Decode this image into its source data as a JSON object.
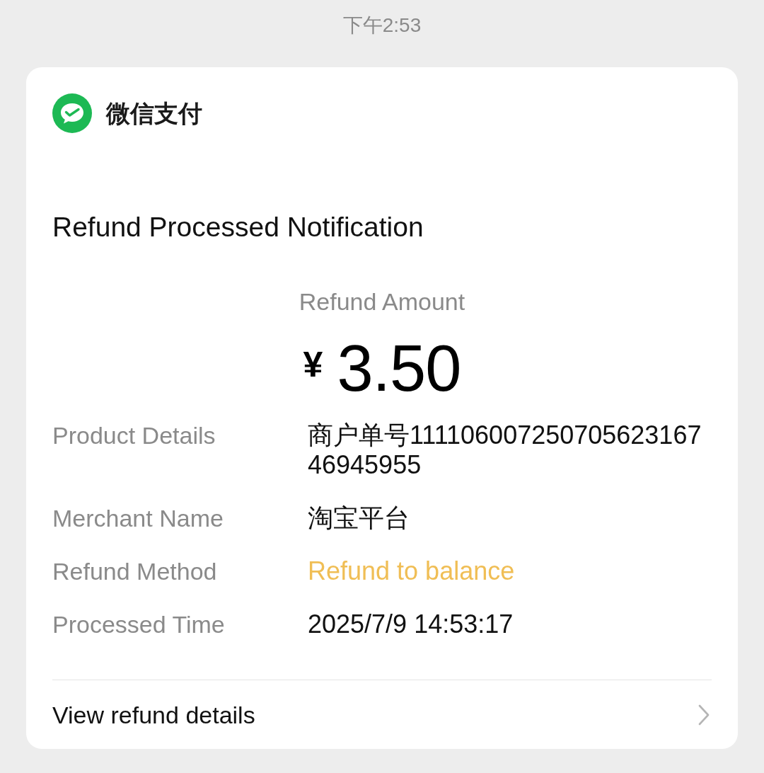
{
  "status_bar": {
    "time": "下午2:53"
  },
  "card": {
    "brand": "微信支付",
    "title": "Refund Processed Notification",
    "amount": {
      "label": "Refund Amount",
      "currency": "¥",
      "value": "3.50"
    },
    "details": [
      {
        "label": "Product Details",
        "value": "商户单号11110600725070562316746945955",
        "kind": "plain"
      },
      {
        "label": "Merchant Name",
        "value": "淘宝平台",
        "kind": "plain"
      },
      {
        "label": "Refund Method",
        "value": "Refund to balance",
        "kind": "accent"
      },
      {
        "label": "Processed Time",
        "value": "2025/7/9 14:53:17",
        "kind": "plain"
      }
    ],
    "footer": {
      "label": "View refund details"
    }
  }
}
